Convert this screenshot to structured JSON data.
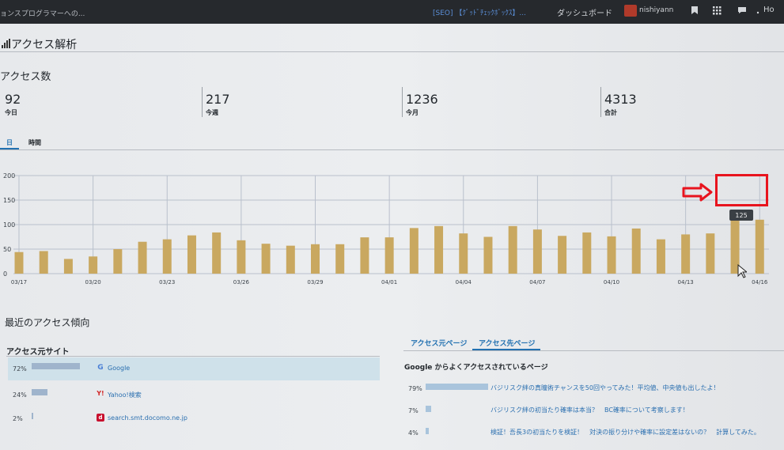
{
  "adminbar": {
    "site_name": "ョンスプログラマーへの...",
    "notice": "[SEO] 【ｸﾞｯﾄﾞﾁｪｯｸﾎﾞｯｸｽ】...",
    "dashboard": "ダッシュボード",
    "username": "nishiyann",
    "more": "Ho"
  },
  "page": {
    "title": "アクセス解析",
    "access_count_title": "アクセス数"
  },
  "stats": [
    {
      "value": "92",
      "label": "今日"
    },
    {
      "value": "217",
      "label": "今週"
    },
    {
      "value": "1236",
      "label": "今月"
    },
    {
      "value": "4313",
      "label": "合計"
    }
  ],
  "tabs": {
    "day": "日",
    "hour": "時間"
  },
  "chart_data": {
    "type": "bar",
    "x": [
      "03/17",
      "03/18",
      "03/19",
      "03/20",
      "03/21",
      "03/22",
      "03/23",
      "03/24",
      "03/25",
      "03/26",
      "03/27",
      "03/28",
      "03/29",
      "03/30",
      "03/31",
      "04/01",
      "04/02",
      "04/03",
      "04/04",
      "04/05",
      "04/06",
      "04/07",
      "04/08",
      "04/09",
      "04/10",
      "04/11",
      "04/12",
      "04/13",
      "04/14",
      "04/15",
      "04/16"
    ],
    "values": [
      44,
      46,
      30,
      35,
      50,
      65,
      70,
      78,
      84,
      68,
      61,
      57,
      60,
      60,
      74,
      74,
      93,
      97,
      82,
      75,
      97,
      90,
      77,
      84,
      76,
      92,
      70,
      80,
      82,
      125,
      110
    ],
    "tick_labels": [
      "03/17",
      "03/20",
      "03/23",
      "03/26",
      "03/29",
      "04/01",
      "04/04",
      "04/07",
      "04/10",
      "04/13",
      "04/16"
    ],
    "y_ticks": [
      "0",
      "50",
      "100",
      "150",
      "200"
    ],
    "ylim": [
      0,
      200
    ],
    "tooltip": "125",
    "grid": true,
    "bar_color": "#c9a860"
  },
  "recent": {
    "title": "最近のアクセス傾向",
    "sources_title": "アクセス元サイト",
    "sources": [
      {
        "pct": "72%",
        "fraction": 0.72,
        "icon": "google-icon",
        "name": "Google"
      },
      {
        "pct": "24%",
        "fraction": 0.24,
        "icon": "yahoo-icon",
        "name": "Yahoo!検索"
      },
      {
        "pct": "2%",
        "fraction": 0.02,
        "icon": "docomo-icon",
        "name": "search.smt.docomo.ne.jp"
      }
    ],
    "tab_source_page": "アクセス元ページ",
    "tab_dest_page": "アクセス先ページ",
    "dest_title": "Google からよくアクセスされているページ",
    "dest": [
      {
        "pct": "79%",
        "fraction": 0.79,
        "title": "バジリスク絆の真瞳術チャンスを50回やってみた！平均値、中央値も出したよ！"
      },
      {
        "pct": "7%",
        "fraction": 0.07,
        "title": "バジリスク絆の初当たり確率は本当？　BC確率について考察します！"
      },
      {
        "pct": "4%",
        "fraction": 0.04,
        "title": "検証！吾長3の初当たりを検証！　対決の振り分けや確率に設定差はないの？　計算してみた。"
      }
    ]
  }
}
